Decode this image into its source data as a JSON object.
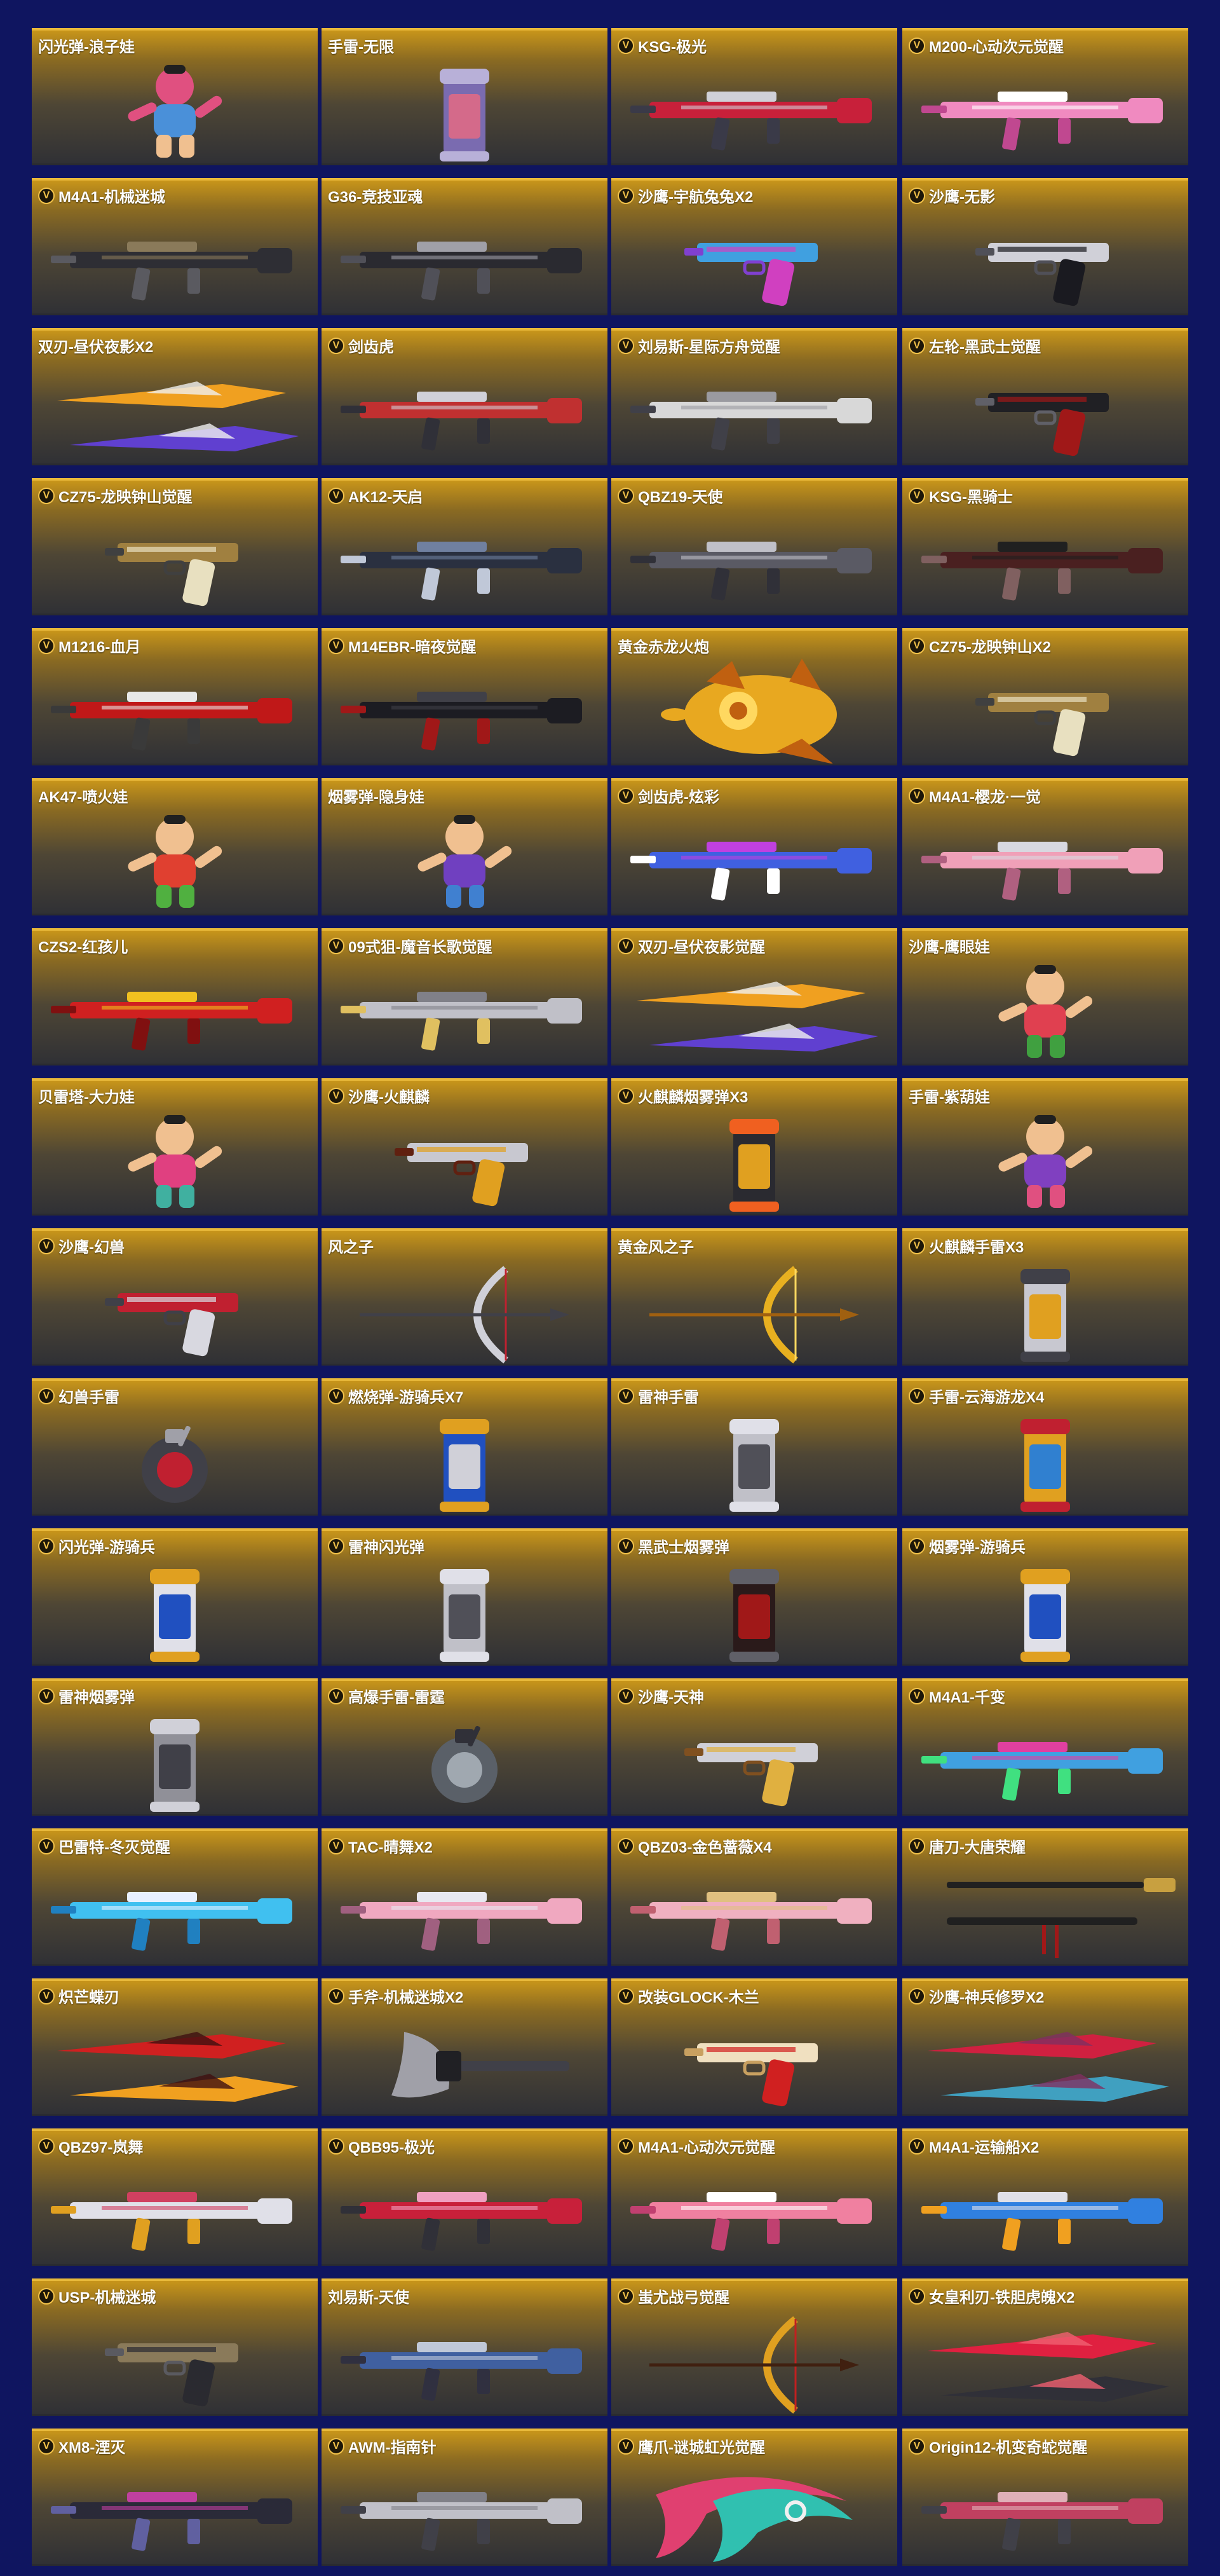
{
  "colors": {
    "page_background": "#0f1560",
    "card_top": "#c8951a",
    "card_bottom": "#2f3035",
    "badge_gold": "#f2c24a"
  },
  "items": [
    {
      "name": "闪光弹-浪子娃",
      "badge": "",
      "kind": "doll",
      "colors": [
        "#4a90d9",
        "#f0c090",
        "#e05080"
      ]
    },
    {
      "name": "手雷-无限",
      "badge": "",
      "kind": "canister",
      "colors": [
        "#7a6bb0",
        "#d46a8a",
        "#b8b0d8"
      ]
    },
    {
      "name": "KSG-极光",
      "badge": "V",
      "kind": "gun",
      "colors": [
        "#c8203a",
        "#d0d0d8",
        "#3a3a48"
      ]
    },
    {
      "name": "M200-心动次元觉醒",
      "badge": "V",
      "kind": "gun",
      "colors": [
        "#f08ac0",
        "#ffffff",
        "#c04890"
      ]
    },
    {
      "name": "M4A1-机械迷城",
      "badge": "V",
      "kind": "gun",
      "colors": [
        "#2e2e34",
        "#8a7a5a",
        "#5a5a60"
      ]
    },
    {
      "name": "G36-竞技亚魂",
      "badge": "",
      "kind": "gun",
      "colors": [
        "#2a2a30",
        "#a0a0a8",
        "#505058"
      ]
    },
    {
      "name": "沙鹰-宇航兔兔X2",
      "badge": "V",
      "kind": "pistol",
      "colors": [
        "#d040c0",
        "#40a0e0",
        "#8040d0"
      ]
    },
    {
      "name": "沙鹰-无影",
      "badge": "V",
      "kind": "pistol",
      "colors": [
        "#1a1a20",
        "#d0d0d8",
        "#505058"
      ]
    },
    {
      "name": "双刃-昼伏夜影X2",
      "badge": "",
      "kind": "blades",
      "colors": [
        "#f0a020",
        "#6040d0",
        "#f0f0f0"
      ]
    },
    {
      "name": "剑齿虎",
      "badge": "V",
      "kind": "gun",
      "colors": [
        "#c03030",
        "#d0d0d8",
        "#303038"
      ]
    },
    {
      "name": "刘易斯-星际方舟觉醒",
      "badge": "V",
      "kind": "gun",
      "colors": [
        "#d8d8d8",
        "#9a9aa0",
        "#404048"
      ]
    },
    {
      "name": "左轮-黑武士觉醒",
      "badge": "V",
      "kind": "pistol",
      "colors": [
        "#a01818",
        "#202024",
        "#606068"
      ]
    },
    {
      "name": "CZ75-龙映钟山觉醒",
      "badge": "V",
      "kind": "pistol",
      "colors": [
        "#e8e0c0",
        "#a08040",
        "#404040"
      ]
    },
    {
      "name": "AK12-天启",
      "badge": "V",
      "kind": "gun",
      "colors": [
        "#2a3040",
        "#7080a0",
        "#c0c8d8"
      ]
    },
    {
      "name": "QBZ19-天使",
      "badge": "V",
      "kind": "gun",
      "colors": [
        "#5a5a64",
        "#c0c0c8",
        "#303038"
      ]
    },
    {
      "name": "KSG-黑骑士",
      "badge": "V",
      "kind": "gun",
      "colors": [
        "#4a2020",
        "#202020",
        "#806060"
      ]
    },
    {
      "name": "M1216-血月",
      "badge": "V",
      "kind": "gun",
      "colors": [
        "#c01818",
        "#e8e8e8",
        "#3a3a3a"
      ]
    },
    {
      "name": "M14EBR-暗夜觉醒",
      "badge": "V",
      "kind": "gun",
      "colors": [
        "#1c1c22",
        "#404048",
        "#a01818"
      ]
    },
    {
      "name": "黄金赤龙火炮",
      "badge": "",
      "kind": "dragon",
      "colors": [
        "#e8a820",
        "#c06010",
        "#ffd860"
      ]
    },
    {
      "name": "CZ75-龙映钟山X2",
      "badge": "V",
      "kind": "pistol",
      "colors": [
        "#e8e0c0",
        "#a08040",
        "#404040"
      ]
    },
    {
      "name": "AK47-喷火娃",
      "badge": "",
      "kind": "doll",
      "colors": [
        "#e04030",
        "#50b040",
        "#f0c090"
      ]
    },
    {
      "name": "烟雾弹-隐身娃",
      "badge": "",
      "kind": "doll",
      "colors": [
        "#7040c0",
        "#4080d0",
        "#f0c090"
      ]
    },
    {
      "name": "剑齿虎-炫彩",
      "badge": "V",
      "kind": "gun",
      "colors": [
        "#4060e0",
        "#c040e0",
        "#ffffff"
      ]
    },
    {
      "name": "M4A1-樱龙·一觉",
      "badge": "V",
      "kind": "gun",
      "colors": [
        "#f0a0b8",
        "#d8d8e0",
        "#b06080"
      ]
    },
    {
      "name": "CZS2-红孩儿",
      "badge": "",
      "kind": "gun",
      "colors": [
        "#d02020",
        "#f0c020",
        "#801010"
      ]
    },
    {
      "name": "09式狙-魔音长歌觉醒",
      "badge": "V",
      "kind": "gun",
      "colors": [
        "#c0c0c8",
        "#808088",
        "#e0c060"
      ]
    },
    {
      "name": "双刃-昼伏夜影觉醒",
      "badge": "V",
      "kind": "blades",
      "colors": [
        "#f0a020",
        "#6040d0",
        "#f0f0f0"
      ]
    },
    {
      "name": "沙鹰-鹰眼娃",
      "badge": "",
      "kind": "doll",
      "colors": [
        "#e04050",
        "#40a040",
        "#f0c090"
      ]
    },
    {
      "name": "贝雷塔-大力娃",
      "badge": "",
      "kind": "doll",
      "colors": [
        "#e04080",
        "#40b0a0",
        "#f0c090"
      ]
    },
    {
      "name": "沙鹰-火麒麟",
      "badge": "V",
      "kind": "pistol",
      "colors": [
        "#e0a020",
        "#c8c8d0",
        "#602010"
      ]
    },
    {
      "name": "火麒麟烟雾弹X3",
      "badge": "V",
      "kind": "canister",
      "colors": [
        "#2a2a30",
        "#e0a020",
        "#f06020"
      ]
    },
    {
      "name": "手雷-紫葫娃",
      "badge": "",
      "kind": "doll",
      "colors": [
        "#8040c0",
        "#e05080",
        "#f0c090"
      ]
    },
    {
      "name": "沙鹰-幻兽",
      "badge": "V",
      "kind": "pistol",
      "colors": [
        "#d8d8e0",
        "#c02030",
        "#404048"
      ]
    },
    {
      "name": "风之子",
      "badge": "",
      "kind": "bow",
      "colors": [
        "#d0d0d8",
        "#c02030",
        "#404048"
      ]
    },
    {
      "name": "黄金风之子",
      "badge": "",
      "kind": "bow",
      "colors": [
        "#e8b020",
        "#ffd860",
        "#a06010"
      ]
    },
    {
      "name": "火麒麟手雷X3",
      "badge": "V",
      "kind": "canister",
      "colors": [
        "#c8c8d0",
        "#e0a020",
        "#404048"
      ]
    },
    {
      "name": "幻兽手雷",
      "badge": "V",
      "kind": "grenade",
      "colors": [
        "#404048",
        "#c02030",
        "#a0a0a8"
      ]
    },
    {
      "name": "燃烧弹-游骑兵X7",
      "badge": "V",
      "kind": "canister",
      "colors": [
        "#2050c0",
        "#d0d0d8",
        "#e0a020"
      ]
    },
    {
      "name": "雷神手雷",
      "badge": "V",
      "kind": "canister",
      "colors": [
        "#c0c0c8",
        "#505058",
        "#e0e0e8"
      ]
    },
    {
      "name": "手雷-云海游龙X4",
      "badge": "V",
      "kind": "canister",
      "colors": [
        "#e0a020",
        "#3080d0",
        "#c02030"
      ]
    },
    {
      "name": "闪光弹-游骑兵",
      "badge": "V",
      "kind": "canister",
      "colors": [
        "#e0e0e8",
        "#2050c0",
        "#e0a020"
      ]
    },
    {
      "name": "雷神闪光弹",
      "badge": "V",
      "kind": "canister",
      "colors": [
        "#c0c0c8",
        "#505058",
        "#e0e0e8"
      ]
    },
    {
      "name": "黑武士烟雾弹",
      "badge": "V",
      "kind": "canister",
      "colors": [
        "#2a1a1a",
        "#a01818",
        "#606068"
      ]
    },
    {
      "name": "烟雾弹-游骑兵",
      "badge": "V",
      "kind": "canister",
      "colors": [
        "#e0e0e8",
        "#2050c0",
        "#e0a020"
      ]
    },
    {
      "name": "雷神烟雾弹",
      "badge": "V",
      "kind": "canister",
      "colors": [
        "#909098",
        "#404048",
        "#d0d0d8"
      ]
    },
    {
      "name": "高爆手雷-雷霆",
      "badge": "V",
      "kind": "grenade",
      "colors": [
        "#5a6068",
        "#a0a8b0",
        "#303038"
      ]
    },
    {
      "name": "沙鹰-天神",
      "badge": "V",
      "kind": "pistol",
      "colors": [
        "#e0b040",
        "#d0d0d8",
        "#805020"
      ]
    },
    {
      "name": "M4A1-千变",
      "badge": "V",
      "kind": "gun",
      "colors": [
        "#40a0e0",
        "#e040a0",
        "#40e080"
      ]
    },
    {
      "name": "巴雷特-冬灭觉醒",
      "badge": "V",
      "kind": "gun",
      "colors": [
        "#40c0f0",
        "#e8f0ff",
        "#2080c0"
      ]
    },
    {
      "name": "TAC-晴舞X2",
      "badge": "V",
      "kind": "gun",
      "colors": [
        "#f0a8c0",
        "#e8e8f0",
        "#a06080"
      ]
    },
    {
      "name": "QBZ03-金色蔷薇X4",
      "badge": "V",
      "kind": "gun",
      "colors": [
        "#f0b0c0",
        "#e0c080",
        "#c06070"
      ]
    },
    {
      "name": "唐刀-大唐荣耀",
      "badge": "V",
      "kind": "sword",
      "colors": [
        "#202020",
        "#c8a040",
        "#a01818"
      ]
    },
    {
      "name": "炽芒蝶刃",
      "badge": "V",
      "kind": "blades",
      "colors": [
        "#d02020",
        "#f0a020",
        "#401010"
      ]
    },
    {
      "name": "手斧-机械迷城X2",
      "badge": "V",
      "kind": "axe",
      "colors": [
        "#404048",
        "#a0a0a8",
        "#202024"
      ]
    },
    {
      "name": "改装GLOCK-木兰",
      "badge": "V",
      "kind": "pistol",
      "colors": [
        "#d02020",
        "#f0e0c0",
        "#c8a060"
      ]
    },
    {
      "name": "沙鹰-神兵修罗X2",
      "badge": "V",
      "kind": "blades",
      "colors": [
        "#d02040",
        "#40a0c0",
        "#803060"
      ]
    },
    {
      "name": "QBZ97-岚舞",
      "badge": "V",
      "kind": "gun",
      "colors": [
        "#e0e0e8",
        "#d04060",
        "#e0a020"
      ]
    },
    {
      "name": "QBB95-极光",
      "badge": "V",
      "kind": "gun",
      "colors": [
        "#c8203a",
        "#f0a0c0",
        "#303038"
      ]
    },
    {
      "name": "M4A1-心动次元觉醒",
      "badge": "V",
      "kind": "gun",
      "colors": [
        "#f080a0",
        "#ffffff",
        "#c04070"
      ]
    },
    {
      "name": "M4A1-运输船X2",
      "badge": "V",
      "kind": "gun",
      "colors": [
        "#3080e0",
        "#e0e0e8",
        "#f0a020"
      ]
    },
    {
      "name": "USP-机械迷城",
      "badge": "V",
      "kind": "pistol",
      "colors": [
        "#2a2a30",
        "#8a7a5a",
        "#5a5a60"
      ]
    },
    {
      "name": "刘易斯-天使",
      "badge": "",
      "kind": "gun",
      "colors": [
        "#4060a0",
        "#c0c8d8",
        "#303040"
      ]
    },
    {
      "name": "蚩尤战弓觉醒",
      "badge": "V",
      "kind": "bow",
      "colors": [
        "#e0a020",
        "#c02020",
        "#402010"
      ]
    },
    {
      "name": "女皇利刃-铁胆虎魄X2",
      "badge": "V",
      "kind": "blades",
      "colors": [
        "#e02040",
        "#303038",
        "#f06070"
      ]
    },
    {
      "name": "XM8-湮灭",
      "badge": "V",
      "kind": "gun",
      "colors": [
        "#2a2a38",
        "#c040a0",
        "#6060a0"
      ]
    },
    {
      "name": "AWM-指南针",
      "badge": "V",
      "kind": "gun",
      "colors": [
        "#c0c0c8",
        "#808088",
        "#404048"
      ]
    },
    {
      "name": "鹰爪-谜城虹光觉醒",
      "badge": "V",
      "kind": "claw",
      "colors": [
        "#e04070",
        "#30c0b0",
        "#f0f0f0"
      ]
    },
    {
      "name": "Origin12-机变奇蛇觉醒",
      "badge": "V",
      "kind": "gun",
      "colors": [
        "#c04060",
        "#e0b0b8",
        "#404048"
      ]
    }
  ]
}
